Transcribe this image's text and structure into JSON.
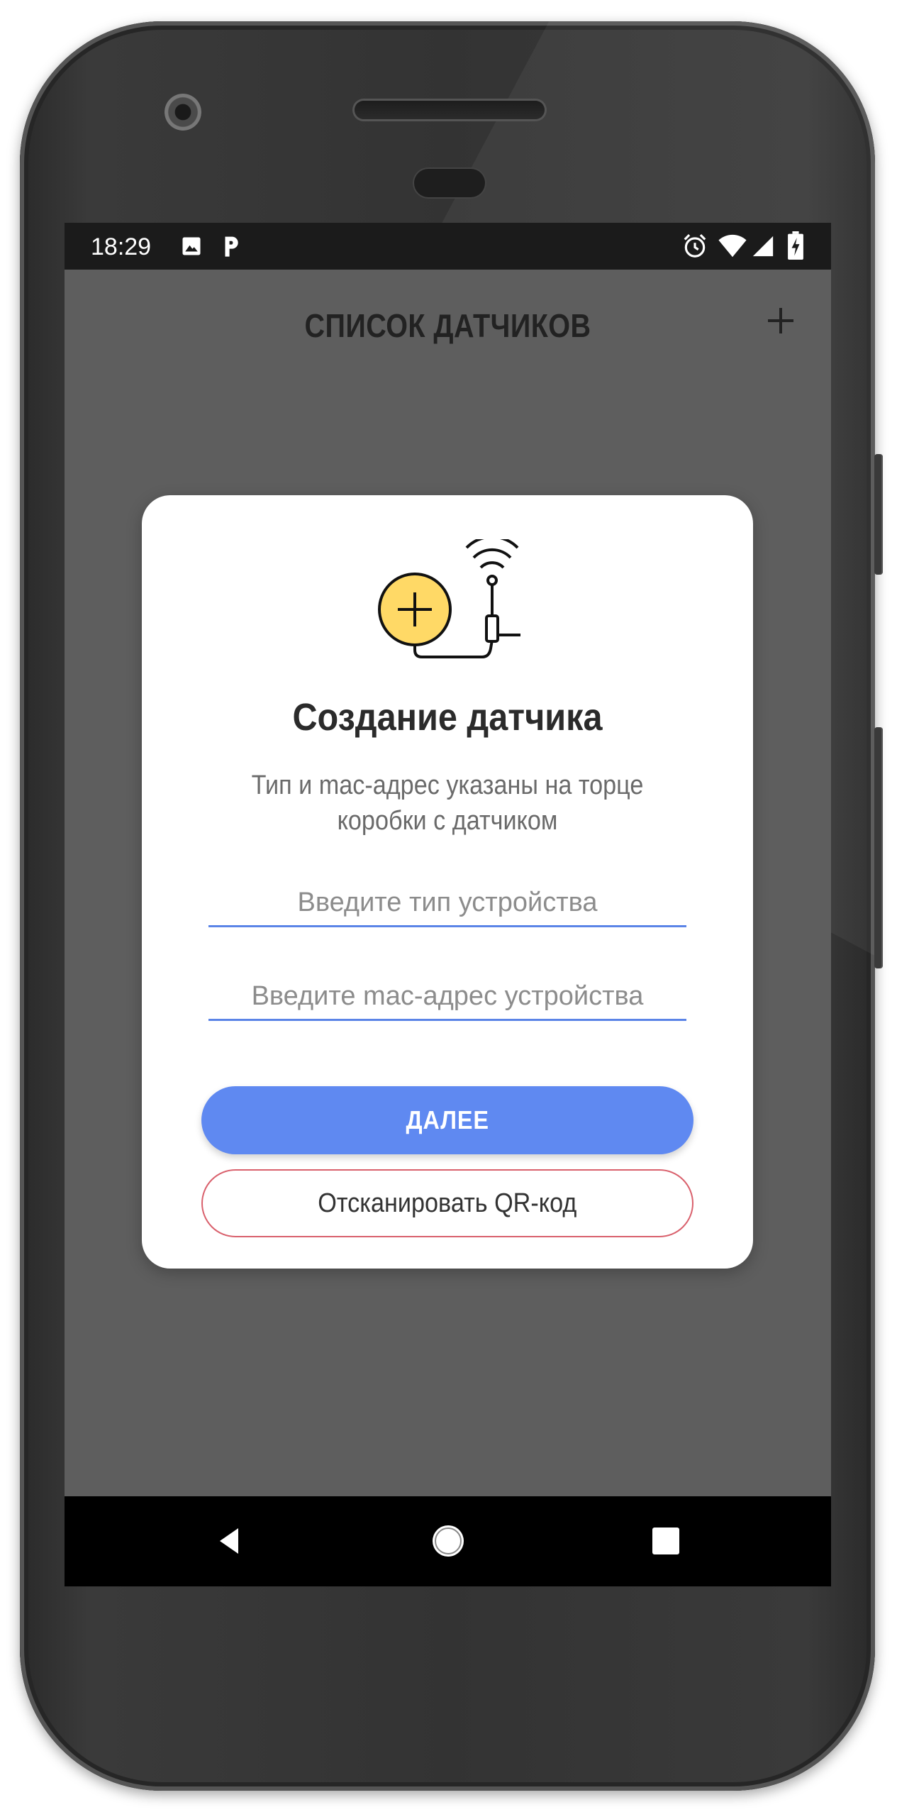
{
  "status_bar": {
    "time": "18:29",
    "left_icons": [
      "image-icon",
      "parking-icon"
    ],
    "right_icons": [
      "alarm-icon",
      "wifi-icon",
      "signal-icon",
      "battery-charging-icon"
    ]
  },
  "header": {
    "title": "СПИСОК ДАТЧИКОВ",
    "add_icon": "plus-icon"
  },
  "dialog": {
    "illustration": "add-sensor-icon",
    "title": "Создание датчика",
    "subtitle": "Тип и mac-адрес указаны на торце коробки с датчиком",
    "device_type_placeholder": "Введите тип устройства",
    "mac_address_placeholder": "Введите mac-адрес устройства",
    "next_button": "ДАЛЕЕ",
    "scan_button": "Отсканировать QR-код"
  },
  "nav_bar": {
    "buttons": [
      "back-icon",
      "home-icon",
      "recents-icon"
    ]
  },
  "colors": {
    "accent": "#5f89f1",
    "scan_border": "#d9606c",
    "illustration_yellow": "#ffd966"
  }
}
